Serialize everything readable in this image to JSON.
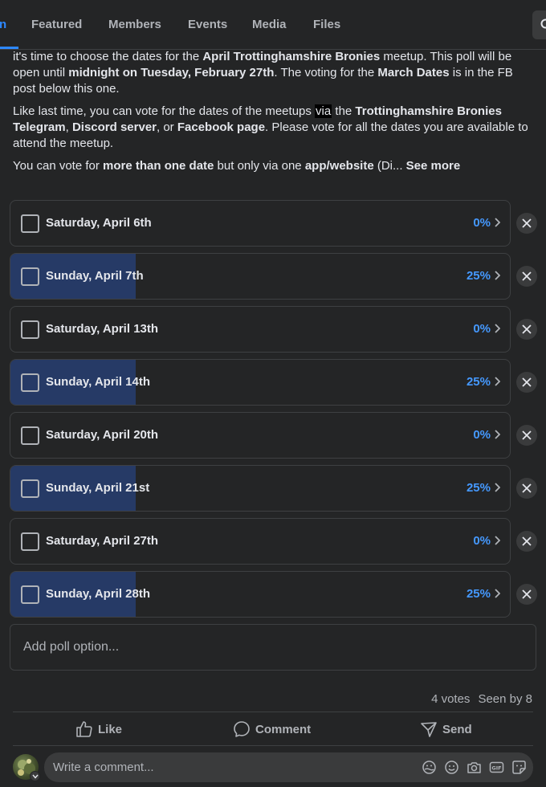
{
  "tabs": [
    {
      "label": "n",
      "active": true
    },
    {
      "label": "Featured"
    },
    {
      "label": "Members"
    },
    {
      "label": "Events"
    },
    {
      "label": "Media"
    },
    {
      "label": "Files"
    }
  ],
  "post": {
    "p1": {
      "t1": "it's time to choose the dates for the ",
      "b1": "April Trottinghamshire Bronies",
      "t2": " meetup. This poll will be open until ",
      "b2": "midnight on Tuesday, February 27th",
      "t3": ". The voting for the ",
      "b3": "March Dates",
      "t4": " is in the FB post below this one."
    },
    "p2": {
      "t1": "Like last time, you can vote for the dates of the meetups ",
      "hl": "via",
      "t2": " the ",
      "b1": "Trottinghamshire Bronies Telegram",
      "t3": ", ",
      "b2": "Discord server",
      "t4": ", or ",
      "b3": "Facebook page",
      "t5": ". Please vote for all the dates you are available to attend the meetup."
    },
    "p3": {
      "t1": "You can vote for ",
      "b1": "more than one date",
      "t2": " but only via one ",
      "b2": "app/website",
      "t3": " (Di... ",
      "see_more": "See more"
    }
  },
  "poll": {
    "options": [
      {
        "label": "Saturday, April 6th",
        "percent": "0%",
        "fill": 0
      },
      {
        "label": "Sunday, April 7th",
        "percent": "25%",
        "fill": 0.25
      },
      {
        "label": "Saturday, April 13th",
        "percent": "0%",
        "fill": 0
      },
      {
        "label": "Sunday, April 14th",
        "percent": "25%",
        "fill": 0.25
      },
      {
        "label": "Saturday, April 20th",
        "percent": "0%",
        "fill": 0
      },
      {
        "label": "Sunday, April 21st",
        "percent": "25%",
        "fill": 0.25
      },
      {
        "label": "Saturday, April 27th",
        "percent": "0%",
        "fill": 0
      },
      {
        "label": "Sunday, April 28th",
        "percent": "25%",
        "fill": 0.25
      }
    ],
    "add_option_placeholder": "Add poll option..."
  },
  "stats": {
    "votes": "4 votes",
    "seen": "Seen by 8"
  },
  "actions": {
    "like": "Like",
    "comment": "Comment",
    "send": "Send"
  },
  "comment": {
    "placeholder": "Write a comment..."
  },
  "colors": {
    "accent": "#2d88ff",
    "poll_fill": "#263a66",
    "percent": "#4599ff",
    "background": "#242526"
  },
  "icons": {
    "search": "search-icon",
    "remove": "close-icon",
    "chevron": "chevron-right-icon",
    "like": "thumbs-up-icon",
    "comment": "speech-bubble-icon",
    "send": "send-icon",
    "comment_tools": [
      "avatar-sticker-icon",
      "emoji-icon",
      "camera-icon",
      "gif-icon",
      "sticker-icon"
    ]
  }
}
